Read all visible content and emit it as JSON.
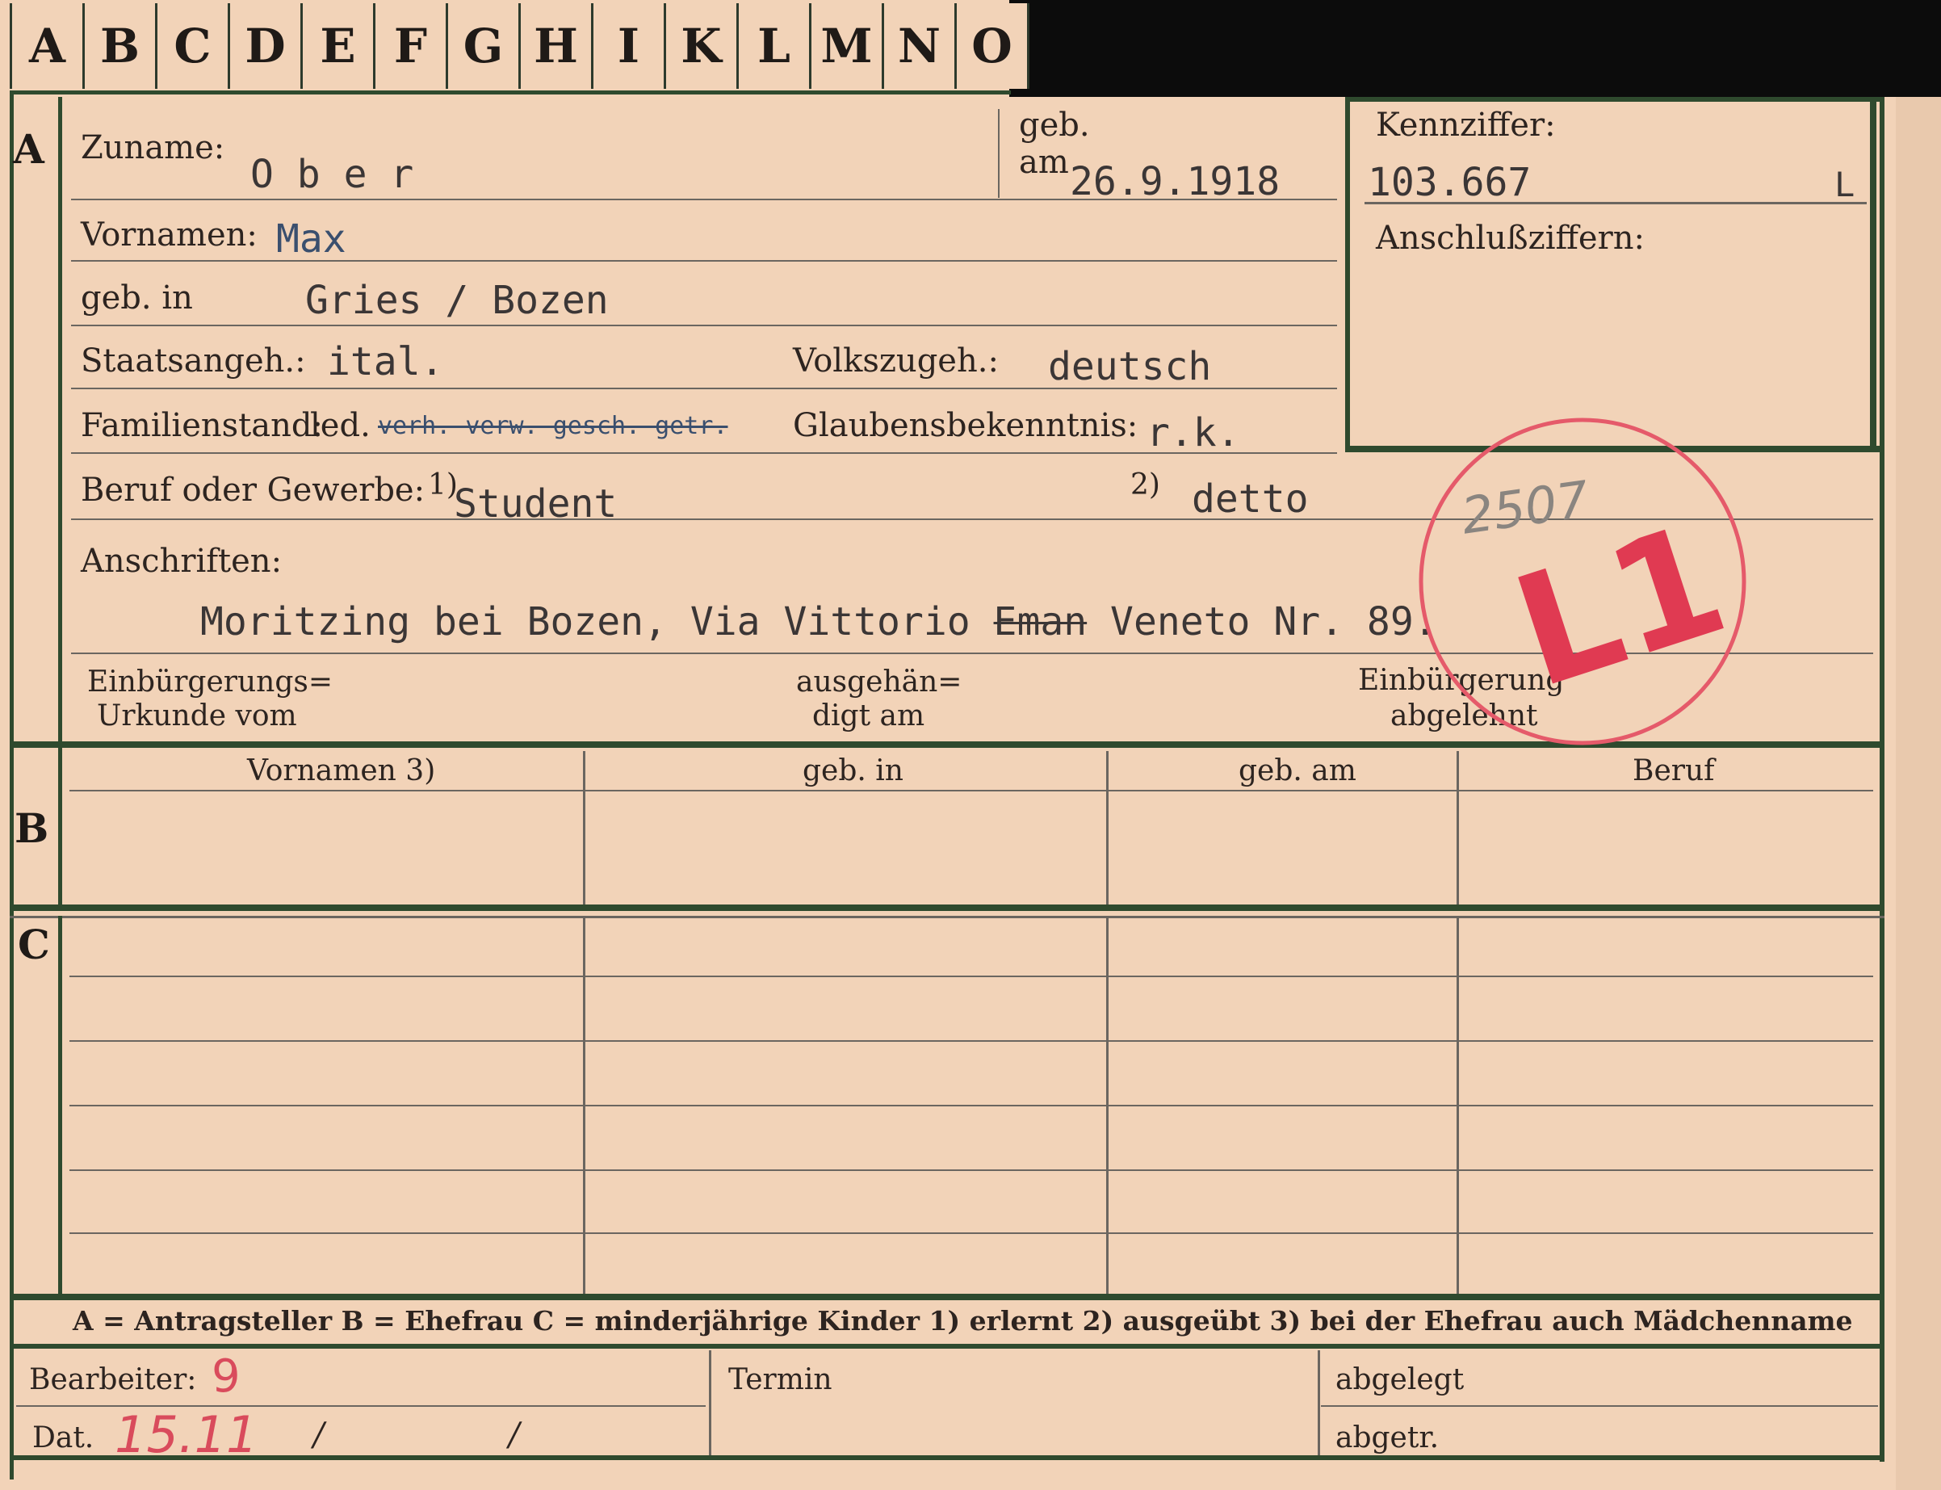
{
  "tabs": [
    "A",
    "B",
    "C",
    "D",
    "E",
    "F",
    "G",
    "H",
    "I",
    "K",
    "L",
    "M",
    "N",
    "O"
  ],
  "sections": {
    "a": "A",
    "b": "B",
    "c": "C"
  },
  "labels": {
    "surname": "Zuname:",
    "born_on": "geb.",
    "born_am": "am",
    "first_names": "Vornamen:",
    "born_in": "geb. in",
    "citizenship": "Staatsangeh.:",
    "ethnicity": "Volkszugeh.:",
    "marital": "Familienstand:",
    "religion": "Glaubensbekenntnis:",
    "occupation": "Beruf oder Gewerbe:",
    "note1": "1)",
    "note2": "2)",
    "addresses": "Anschriften:",
    "naturalization_cert_1": "Einbürgerungs=",
    "naturalization_cert_2": "Urkunde vom",
    "handed_out_1": "ausgehän=",
    "handed_out_2": "digt am",
    "rejected_1": "Einbürgerung",
    "rejected_2": "abgelehnt",
    "reference": "Kennziffer:",
    "linked": "Anschlußziffern:",
    "worker": "Bearbeiter:",
    "date": "Dat.",
    "deadline": "Termin",
    "filed": "abgelegt",
    "abgetr": "abgetr."
  },
  "table_headers": [
    "Vornamen 3)",
    "geb. in",
    "geb. am",
    "Beruf"
  ],
  "legend": "A = Antragsteller   B = Ehefrau   C = minderjährige Kinder   1) erlernt   2) ausgeübt   3) bei der Ehefrau auch Mädchenname",
  "values": {
    "surname": "O b e r",
    "birth_date": "26.9.1918",
    "first_name": "Max",
    "birthplace": "Gries / Bozen",
    "citizenship": "ital.",
    "ethnicity": "deutsch",
    "marital_prefix": "led.",
    "marital_struck": "verh. verw. gesch. getr.",
    "religion": "r.k.",
    "occupation_learned": "Student",
    "occupation_practiced": "detto",
    "address_part1": "Moritzing bei Bozen, Via Vittorio ",
    "address_struck": "Eman",
    "address_part2": " Veneto Nr. 89.",
    "reference_number": "103.667",
    "reference_suffix": "L"
  },
  "annotations": {
    "stamp_number": "2507",
    "stamp_code": "L1",
    "worker_initial": "9",
    "date_handwritten": "15.11",
    "date_slash1": "/",
    "date_slash2": "/"
  },
  "colors": {
    "card": "#f2d3b8",
    "rules": "#2f4a2e",
    "stamp": "#e03a52"
  }
}
